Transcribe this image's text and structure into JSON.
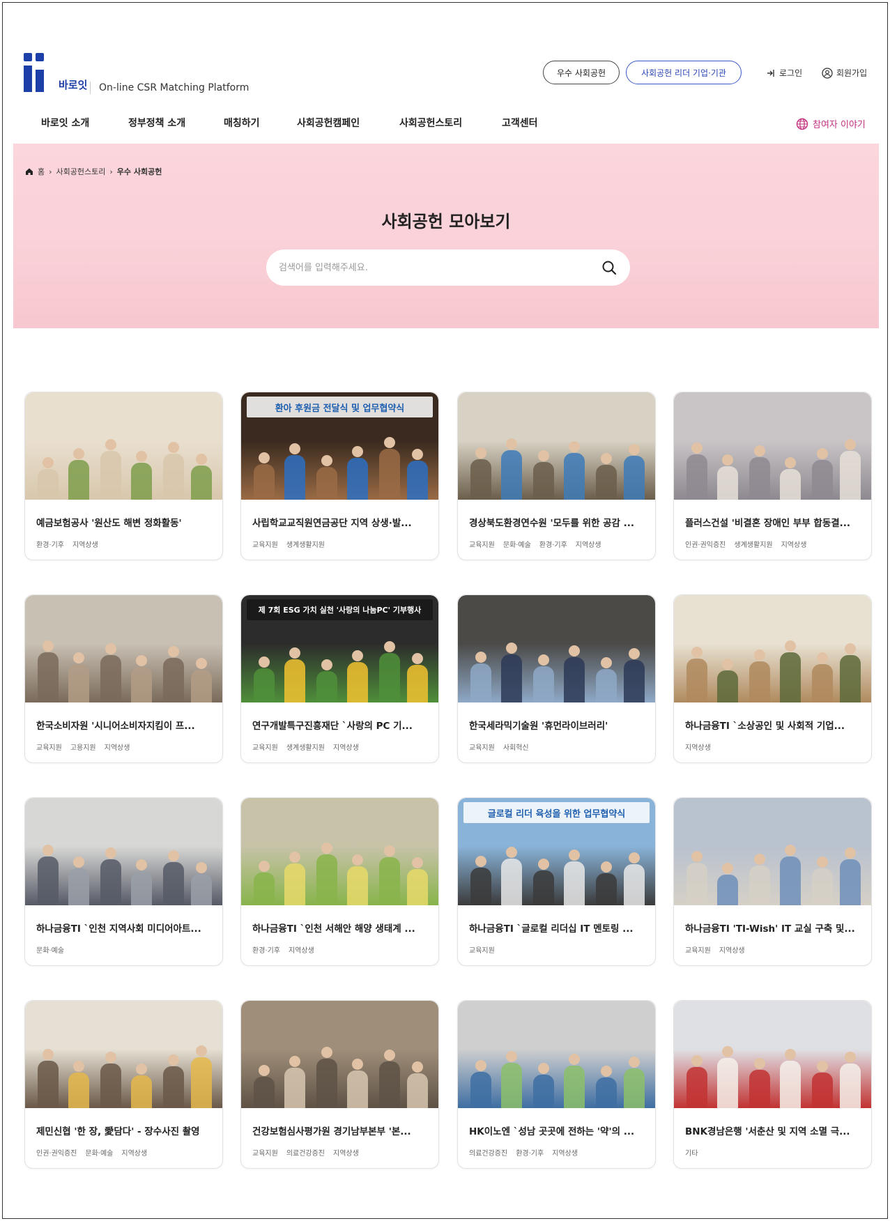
{
  "header": {
    "logo_text": "바로잇",
    "tagline": "On-line CSR Matching Platform",
    "pill_excellent": "우수 사회공헌",
    "pill_leader": "사회공헌 리더 기업·기관",
    "login": "로그인",
    "join": "회원가입"
  },
  "nav": {
    "items": [
      "바로잇 소개",
      "정부정책 소개",
      "매칭하기",
      "사회공헌캠페인",
      "사회공헌스토리",
      "고객센터"
    ],
    "participant": "참여자 이야기"
  },
  "breadcrumb": {
    "home": "홈",
    "level1": "사회공헌스토리",
    "level2": "우수 사회공헌"
  },
  "hero": {
    "title": "사회공헌 모아보기",
    "search_placeholder": "검색어를 입력해주세요."
  },
  "colors": {
    "brand_blue": "#1d3fa8",
    "accent_pink": "#c2307f",
    "hero_bg": "#fad1d8"
  },
  "cards": [
    {
      "title": "예금보험공사 '원산도 해변 정화활동'",
      "tags": [
        "환경·기후",
        "지역상생"
      ],
      "photo_banner": ""
    },
    {
      "title": "사립학교교직원연금공단 지역 상생·발...",
      "tags": [
        "교육지원",
        "생계생활지원"
      ],
      "photo_banner": "환아 후원금 전달식 및 업무협약식"
    },
    {
      "title": "경상북도환경연수원 '모두를 위한 공감 ...",
      "tags": [
        "교육지원",
        "문화·예술",
        "환경·기후",
        "지역상생"
      ],
      "photo_banner": ""
    },
    {
      "title": "플러스건설 '비결혼 장애인 부부 합동결...",
      "tags": [
        "인권·권익증진",
        "생계생활지원",
        "지역상생"
      ],
      "photo_banner": ""
    },
    {
      "title": "한국소비자원 '시니어소비자지킴이 프...",
      "tags": [
        "교육지원",
        "고용지원",
        "지역상생"
      ],
      "photo_banner": ""
    },
    {
      "title": "연구개발특구진흥재단 `사랑의 PC 기...",
      "tags": [
        "교육지원",
        "생계생활지원",
        "지역상생"
      ],
      "photo_banner": "제 7회 ESG 가치 실천 '사랑의 나눔PC' 기부행사"
    },
    {
      "title": "한국세라믹기술원 '휴먼라이브러리'",
      "tags": [
        "교육지원",
        "사회혁신"
      ],
      "photo_banner": ""
    },
    {
      "title": "하나금융TI `소상공인 및 사회적 기업...",
      "tags": [
        "지역상생"
      ],
      "photo_banner": ""
    },
    {
      "title": "하나금융TI `인천 지역사회 미디어아트...",
      "tags": [
        "문화·예술"
      ],
      "photo_banner": ""
    },
    {
      "title": "하나금융TI `인천 서해안 해양 생태계 ...",
      "tags": [
        "환경·기후",
        "지역상생"
      ],
      "photo_banner": ""
    },
    {
      "title": "하나금융TI `글로컬 리더십 IT 멘토링 ...",
      "tags": [
        "교육지원"
      ],
      "photo_banner": "글로컬 리더 육성을 위한 업무협약식"
    },
    {
      "title": "하나금융TI 'TI-Wish' IT 교실 구축 및...",
      "tags": [
        "교육지원",
        "지역상생"
      ],
      "photo_banner": ""
    },
    {
      "title": "제민신협 '한 장, 愛담다' - 장수사진 촬영",
      "tags": [
        "인권·권익증진",
        "문화·예술",
        "지역상생"
      ],
      "photo_banner": ""
    },
    {
      "title": "건강보험심사평가원 경기남부본부 '본...",
      "tags": [
        "교육지원",
        "의료건강증진",
        "지역상생"
      ],
      "photo_banner": ""
    },
    {
      "title": "HK이노엔 `성남 곳곳에 전하는 '약'의 ...",
      "tags": [
        "의료건강증진",
        "환경·기후",
        "지역상생"
      ],
      "photo_banner": ""
    },
    {
      "title": "BNK경남은행 '서춘산 및 지역 소멸 극...",
      "tags": [
        "기타"
      ],
      "photo_banner": ""
    }
  ]
}
